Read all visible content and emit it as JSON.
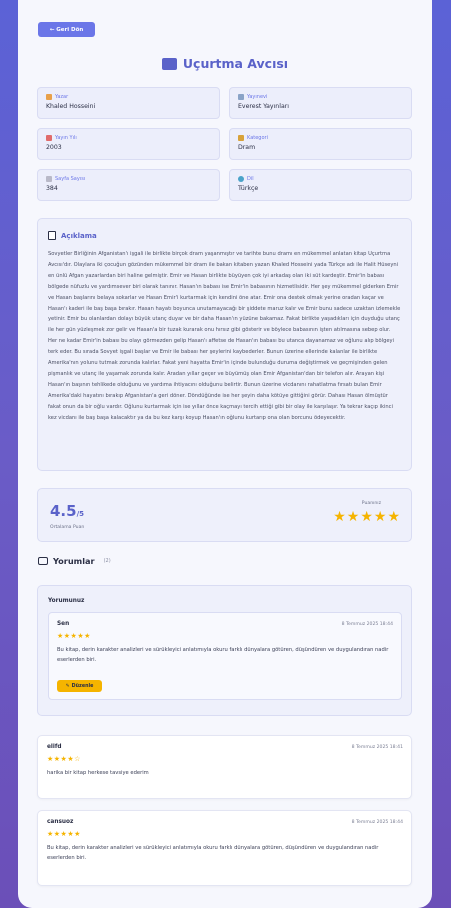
{
  "back_button": {
    "label": "← Geri Dön"
  },
  "title": "Uçurtma Avcısı",
  "info": {
    "author": {
      "label": "Yazar",
      "value": "Khaled Hosseini"
    },
    "publisher": {
      "label": "Yayınevi",
      "value": "Everest Yayınları"
    },
    "year": {
      "label": "Yayın Yılı",
      "value": "2003"
    },
    "category": {
      "label": "Kategori",
      "value": "Dram"
    },
    "pages": {
      "label": "Sayfa Sayısı",
      "value": "384"
    },
    "language": {
      "label": "Dil",
      "value": "Türkçe"
    }
  },
  "description": {
    "heading": "Açıklama",
    "text": "Sovyetler Birliğinin Afganistan'ı işgali ile birlikte birçok dram yaşanmıştır ve tarihte bunu dramı en mükemmel anlatan kitap Uçurtma Avcısı'dır. Olaylara iki çocuğun gözünden mükemmel bir dram ile bakan kitaben yazan Khaled Hosseini yada Türkçe adı ile Halit Hüseyni en ünlü Afgan yazarlardan biri haline gelmiştir. Emir ve Hasan birlikte büyüyen çok iyi arkadaş olan iki süt kardeştir. Emir'in babası bölgede nüfuzlu ve yardımsever biri olarak tanınır. Hasan'ın babası ise Emir'in babasının hizmetlisidir. Her şey mükemmel giderken Emir ve Hasan başlarını belaya sokarlar ve Hasan Emir'i kurtarmak için kendini öne atar. Emir ona destek olmak yerine oradan kaçar ve Hasan'ı kaderi ile baş başa bırakır. Hasan hayatı boyunca unutamayacağı bir şiddete maruz kalır ve Emir bunu sadece uzaktan izlemekle yetinir. Emir bu olanlardan dolayı büyük utanç duyar ve bir daha Hasan'ın yüzüne bakamaz. Fakat birlikte yaşadıkları için duyduğu utanç ile her gün yüzleşmek zor gelir ve Hasan'a bir tuzak kurarak onu hırsız gibi gösterir ve böylece babasının işten atılmasına sebep olur. Her ne kadar Emir'in babası bu olayı görmezden gelip Hasan'ı affetse de Hasan'ın babası bu utanca dayanamaz ve oğlunu alıp bölgeyi terk eder. Bu sırada Sovyet işgali başlar ve Emir ile babası her şeylerini kaybederler. Bunun üzerine ellerinde kalanlar ile birlikte Amerika'nın yolunu tutmak zorunda kalırlar. Fakat yeni hayatta Emir'in içinde bulunduğu duruma değiştirmek ve geçmişinden gelen pişmanlık ve utanç ile yaşamak zorunda kalır. Aradan yıllar geçer ve büyümüş olan Emir Afganistan'dan bir telefon alır. Arayan kişi Hasan'ın başının tehlikede olduğunu ve yardıma ihtiyacını olduğunu belirtir. Bunun üzerine vicdanını rahatlatma fırsatı bulan Emir Amerika'daki hayatını bırakıp Afganistan'a geri döner. Döndüğünde ise her şeyin daha kötüye gittiğini görür. Dahası Hasan ölmüştür fakat onun da bir oğlu vardır. Oğlunu kurtarmak için ise yıllar önce kaçmayı tercih ettiği gibi bir olay ile karşılaşır. Ya tekrar kaçıp ikinci kez vicdanı ile baş başa kalacaktır ya da bu kez karşı koyup Hasan'ın oğlunu kurtarıp ona olan borcunu ödeyecektir."
  },
  "rating": {
    "average": "4.5",
    "out_of": "/5",
    "average_label": "Ortalama Puan",
    "your_label": "Puanınız",
    "your_stars": "★★★★★"
  },
  "comments": {
    "heading": "Yorumlar",
    "count": "(2)",
    "your_heading": "Yorumunuz",
    "your_comment": {
      "user": "Sen",
      "date": "8 Temmuz 2025 18:44",
      "stars": "★★★★★",
      "text": "Bu kitap, derin karakter analizleri ve sürükleyici anlatımıyla okuru farklı dünyalara götüren, düşündüren ve duygulandıran nadir eserlerden biri.",
      "edit_label": "Düzenle"
    },
    "list": [
      {
        "user": "elifd",
        "date": "8 Temmuz 2025 18:41",
        "stars": "★★★★☆",
        "text": "harika bir kitap herkese tavsiye ederim"
      },
      {
        "user": "cansuoz",
        "date": "8 Temmuz 2025 18:44",
        "stars": "★★★★★",
        "text": "Bu kitap, derin karakter analizleri ve sürükleyici anlatımıyla okuru farklı dünyalara götüren, düşündüren ve duygulandıran nadir eserlerden biri."
      }
    ]
  },
  "colors": {
    "accent": "#5a62c9",
    "button": "#6b76e8",
    "star": "#f5b400"
  }
}
